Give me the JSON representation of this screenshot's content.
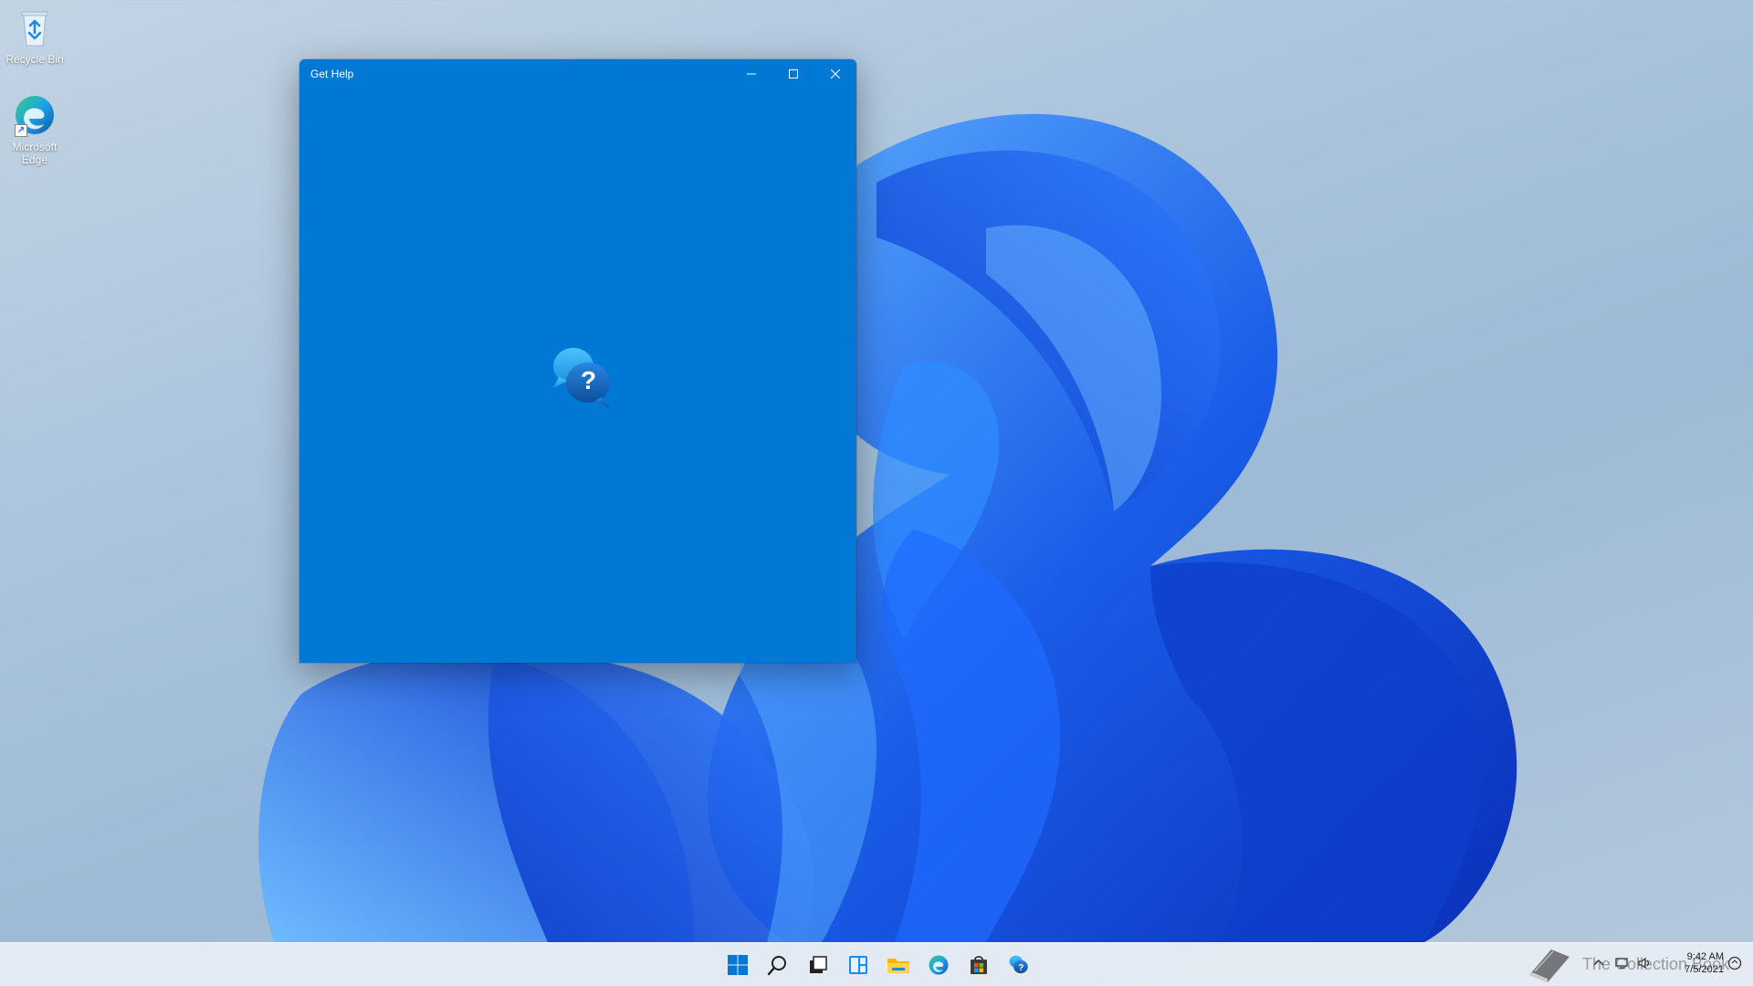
{
  "desktop": {
    "icons": [
      {
        "label": "Recycle Bin",
        "icon": "recycle-bin-icon"
      },
      {
        "label": "Microsoft Edge",
        "icon": "edge-icon"
      }
    ]
  },
  "window": {
    "title": "Get Help",
    "background": "#0078d4",
    "splash_icon": "help-chat-icon",
    "splash_glyph": "?"
  },
  "taskbar": {
    "items": [
      {
        "name": "start",
        "icon": "windows-logo-icon"
      },
      {
        "name": "search",
        "icon": "search-icon"
      },
      {
        "name": "task-view",
        "icon": "task-view-icon"
      },
      {
        "name": "widgets",
        "icon": "widgets-icon"
      },
      {
        "name": "file-explorer",
        "icon": "folder-icon"
      },
      {
        "name": "edge",
        "icon": "edge-icon"
      },
      {
        "name": "store",
        "icon": "store-icon"
      },
      {
        "name": "get-help",
        "icon": "help-chat-icon"
      }
    ],
    "clock": {
      "time": "9:42 AM",
      "date": "7/5/2021"
    },
    "tray_icons": [
      "chevron-up-icon",
      "network-icon",
      "volume-icon",
      "notification-icon"
    ]
  },
  "watermark": {
    "text": "The Collection Book",
    "icon": "book-icon"
  },
  "colors": {
    "accent": "#0078d4",
    "bloom_dark": "#0a2fb8",
    "bloom_light": "#3b8cff"
  }
}
